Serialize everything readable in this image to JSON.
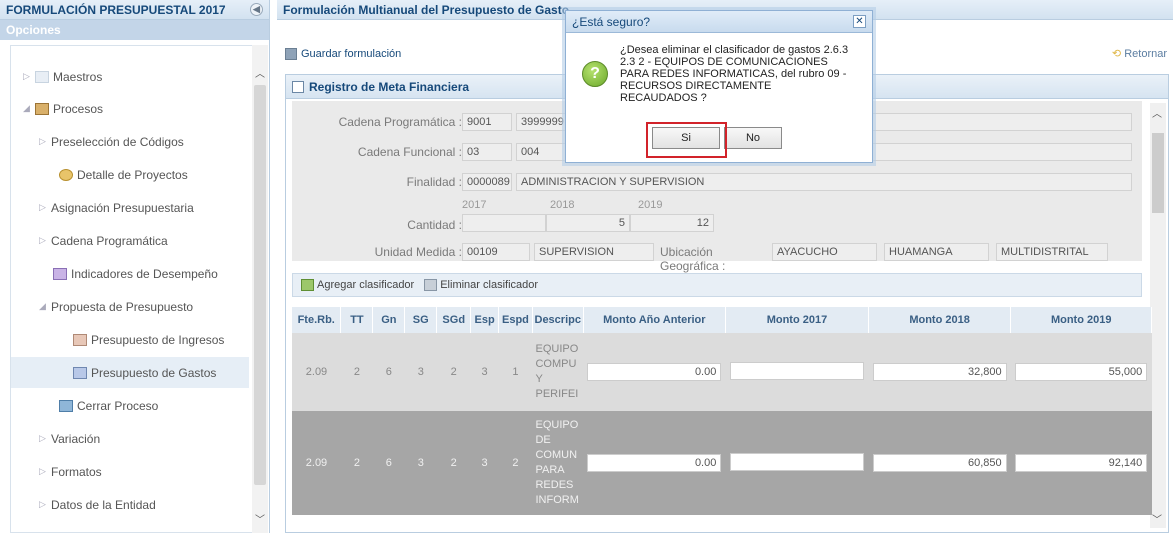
{
  "left_panel": {
    "title": "FORMULACIÓN PRESUPUESTAL 2017",
    "options_label": "Opciones",
    "items": [
      {
        "label": "Maestros",
        "arrow": "▷"
      },
      {
        "label": "Procesos",
        "arrow": "◢"
      },
      {
        "label": "Preselección de Códigos",
        "arrow": "▷"
      },
      {
        "label": "Detalle de Proyectos",
        "arrow": ""
      },
      {
        "label": "Asignación Presupuestaria",
        "arrow": "▷"
      },
      {
        "label": "Cadena Programática",
        "arrow": "▷"
      },
      {
        "label": "Indicadores de Desempeño",
        "arrow": ""
      },
      {
        "label": "Propuesta de Presupuesto",
        "arrow": "◢"
      },
      {
        "label": "Presupuesto de Ingresos",
        "arrow": ""
      },
      {
        "label": "Presupuesto de Gastos",
        "arrow": ""
      },
      {
        "label": "Cerrar Proceso",
        "arrow": ""
      },
      {
        "label": "Variación",
        "arrow": "▷"
      },
      {
        "label": "Formatos",
        "arrow": "▷"
      },
      {
        "label": "Datos de la Entidad",
        "arrow": "▷"
      }
    ]
  },
  "main": {
    "title": "Formulación Multianual del Presupuesto de Gasto",
    "save_label": "Guardar formulación",
    "return_label": "Retornar",
    "panel_title": "Registro de Meta Financiera",
    "form": {
      "cadena_programatica_label": "Cadena Programática :",
      "cadena_programatica_values": [
        "9001",
        "3999999"
      ],
      "cadena_funcional_label": "Cadena Funcional :",
      "cadena_funcional_values": [
        "03",
        "004"
      ],
      "finalidad_label": "Finalidad :",
      "finalidad_code": "0000089",
      "finalidad_desc": "ADMINISTRACION Y SUPERVISION",
      "cantidad_label": "Cantidad :",
      "years": [
        "2017",
        "2018",
        "2019"
      ],
      "cantidad_values": [
        "",
        "5",
        "12"
      ],
      "unidad_medida_label": "Unidad Medida :",
      "unidad_medida_code": "00109",
      "unidad_medida_desc": "SUPERVISION",
      "ubicacion_label": "Ubicación Geográfica :",
      "ubicacion_values": [
        "AYACUCHO",
        "HUAMANGA",
        "MULTIDISTRITAL"
      ]
    },
    "sub_toolbar": {
      "add_label": "Agregar clasificador",
      "delete_label": "Eliminar clasificador"
    },
    "table": {
      "headers": [
        "Fte.Rb.",
        "TT",
        "Gn",
        "SG",
        "SGd",
        "Esp",
        "Espd",
        "Descripc",
        "Monto Año Anterior",
        "Monto 2017",
        "Monto 2018",
        "Monto 2019"
      ],
      "rows": [
        {
          "fte": "2.09",
          "tt": "2",
          "gn": "6",
          "sg": "3",
          "sgd": "2",
          "esp": "3",
          "espd": "1",
          "desc": [
            "EQUIPO",
            "COMPU",
            "Y",
            "PERIFEI"
          ],
          "anterior": "0.00",
          "m2017": "",
          "m2018": "32,800",
          "m2019": "55,000"
        },
        {
          "fte": "2.09",
          "tt": "2",
          "gn": "6",
          "sg": "3",
          "sgd": "2",
          "esp": "3",
          "espd": "2",
          "desc": [
            "EQUIPO",
            "DE",
            "COMUN",
            "PARA",
            "REDES",
            "INFORM"
          ],
          "anterior": "0.00",
          "m2017": "",
          "m2018": "60,850",
          "m2019": "92,140"
        }
      ]
    }
  },
  "modal": {
    "title": "¿Está seguro?",
    "close_glyph": "✕",
    "icon_glyph": "?",
    "message_lines": [
      "¿Desea eliminar el clasificador de gastos 2.6.3",
      "2.3 2 - EQUIPOS DE COMUNICACIONES",
      "PARA REDES INFORMATICAS, del rubro 09 -",
      "RECURSOS DIRECTAMENTE",
      "RECAUDADOS ?"
    ],
    "yes_label": "Si",
    "no_label": "No"
  },
  "colors": {
    "accent": "#16497a",
    "highlight": "#d2232a"
  }
}
